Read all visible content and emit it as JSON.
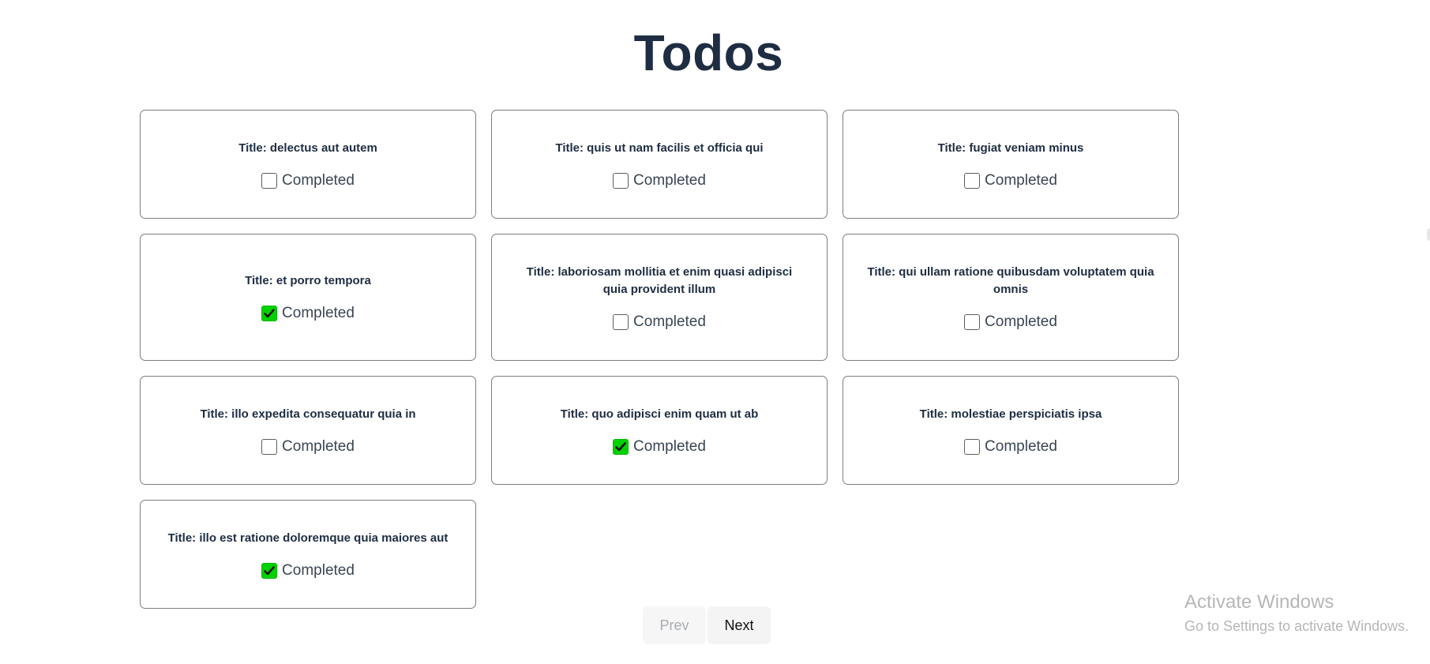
{
  "page": {
    "title": "Todos"
  },
  "todos": [
    {
      "title": "Title: delectus aut autem",
      "completed_label": "Completed",
      "completed": false
    },
    {
      "title": "Title: quis ut nam facilis et officia qui",
      "completed_label": "Completed",
      "completed": false
    },
    {
      "title": "Title: fugiat veniam minus",
      "completed_label": "Completed",
      "completed": false
    },
    {
      "title": "Title: et porro tempora",
      "completed_label": "Completed",
      "completed": true
    },
    {
      "title": "Title: laboriosam mollitia et enim quasi adipisci quia provident illum",
      "completed_label": "Completed",
      "completed": false
    },
    {
      "title": "Title: qui ullam ratione quibusdam voluptatem quia omnis",
      "completed_label": "Completed",
      "completed": false
    },
    {
      "title": "Title: illo expedita consequatur quia in",
      "completed_label": "Completed",
      "completed": false
    },
    {
      "title": "Title: quo adipisci enim quam ut ab",
      "completed_label": "Completed",
      "completed": true
    },
    {
      "title": "Title: molestiae perspiciatis ipsa",
      "completed_label": "Completed",
      "completed": false
    },
    {
      "title": "Title: illo est ratione doloremque quia maiores aut",
      "completed_label": "Completed",
      "completed": true
    }
  ],
  "pagination": {
    "prev_label": "Prev",
    "next_label": "Next",
    "prev_disabled": true
  },
  "watermark": {
    "title": "Activate Windows",
    "subtitle": "Go to Settings to activate Windows."
  },
  "colors": {
    "checked": "#00d100",
    "heading": "#1e2d42",
    "border": "#7d7d7d"
  }
}
